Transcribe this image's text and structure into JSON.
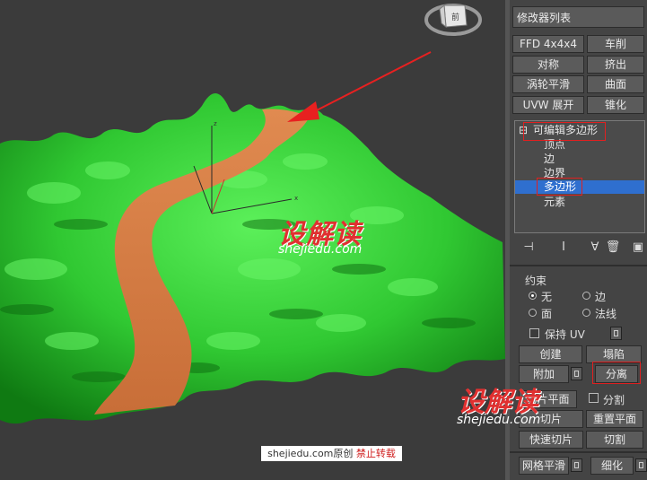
{
  "modifier_list": {
    "label": "修改器列表"
  },
  "modifier_buttons": [
    {
      "left": "FFD 4x4x4",
      "right": "车削"
    },
    {
      "left": "对称",
      "right": "挤出"
    },
    {
      "left": "涡轮平滑",
      "right": "曲面"
    },
    {
      "left": "UVW 展开",
      "right": "锥化"
    }
  ],
  "stack": {
    "expand_glyph": "⊟",
    "root": "可编辑多边形",
    "items": [
      "顶点",
      "边",
      "边界",
      "多边形",
      "元素"
    ],
    "selected": "多边形"
  },
  "constraints": {
    "title": "约束",
    "options": [
      "无",
      "边",
      "面",
      "法线"
    ],
    "selected": "无"
  },
  "preserve_uv": "保持 UV",
  "edit_buttons": {
    "create": "创建",
    "collapse": "塌陷",
    "attach": "附加",
    "detach": "分离",
    "slice_plane": "切片平面",
    "split": "分割",
    "slice": "切片",
    "reset_plane": "重置平面",
    "quick_slice": "快速切片",
    "cut": "切割",
    "meshsmooth": "网格平滑",
    "refine": "细化"
  },
  "viewcube": {
    "label": "前"
  },
  "watermark": {
    "logo": "设解读",
    "url": "shejiedu.com"
  },
  "footer": {
    "site": "shejiedu.com原创",
    "notice": "禁止转载"
  },
  "colors": {
    "terrain": "#35d335",
    "path": "#d47b42",
    "selection": "#2f6fcf",
    "highlight": "#e02020"
  }
}
